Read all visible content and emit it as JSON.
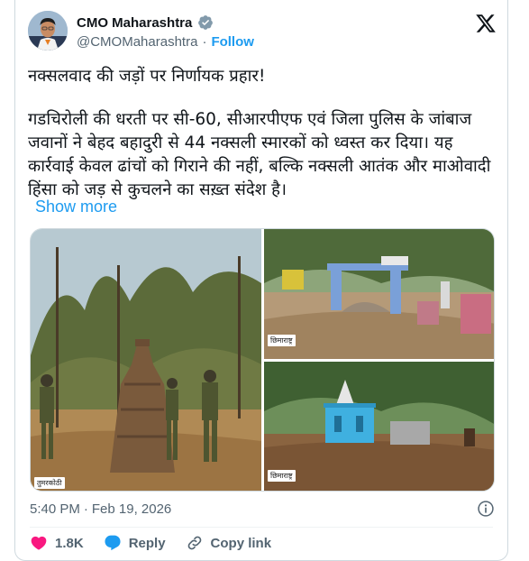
{
  "colors": {
    "accent": "#1d9bf0",
    "verified": "#829aab",
    "like": "#f91880",
    "text": "#0f1419",
    "muted": "#536471"
  },
  "author": {
    "name": "CMO Maharashtra",
    "handle": "@CMOMaharashtra",
    "separator": "·",
    "follow_label": "Follow"
  },
  "post": {
    "paragraph1": "नक्सलवाद की जड़ों पर निर्णायक प्रहार!",
    "paragraph2": "गडचिरोली की धरती पर सी-60, सीआरपीएफ एवं जिला पुलिस के जांबाज जवानों ने बेहद बहादुरी से 44 नक्सली स्मारकों को ध्वस्त कर दिया। यह कार्रवाई केवल ढांचों को गिराने की नहीं, बल्कि नक्सली आतंक और माओवादी हिंसा को जड़ से कुचलने का सख़्त संदेश है।",
    "show_more": "Show more"
  },
  "media": {
    "left_tag": "तुमरकोठी",
    "right_top_tag": "छिमाराष्ट्र",
    "right_bottom_tag": "छिमाराष्ट्र"
  },
  "meta": {
    "time": "5:40 PM",
    "separator": "·",
    "date": "Feb 19, 2026"
  },
  "actions": {
    "likes": "1.8K",
    "reply_label": "Reply",
    "copy_label": "Copy link"
  },
  "icons": [
    "verified-badge-icon",
    "x-logo-icon",
    "info-icon",
    "heart-icon",
    "reply-bubble-icon",
    "link-icon"
  ]
}
